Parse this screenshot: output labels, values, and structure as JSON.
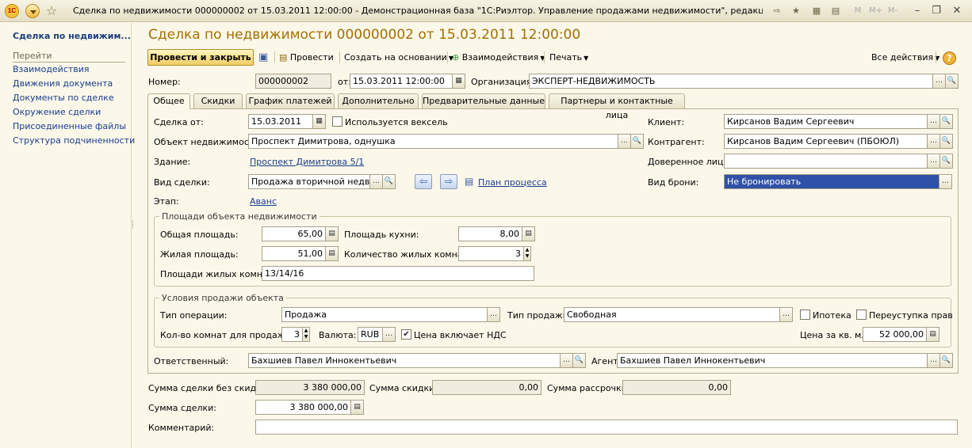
{
  "window": {
    "title": "Сделка по недвижимости 000000002 от 15.03.2011 12:00:00 - Демонстрационная база \"1С:Риэлтор. Управление продажами недвижимости\", редакци... (1С:Предприятие)",
    "logo": "1С",
    "m_labels": [
      "M",
      "M+",
      "M-"
    ]
  },
  "sidebar": {
    "title": "Сделка по недвижим...",
    "group": "Перейти",
    "items": [
      "Взаимодействия",
      "Движения документа",
      "Документы по сделке",
      "Окружение сделки",
      "Присоединенные файлы",
      "Структура подчиненности"
    ]
  },
  "document": {
    "title": "Сделка по недвижимости 000000002 от 15.03.2011 12:00:00"
  },
  "toolbar": {
    "post_close": "Провести и закрыть",
    "post": "Провести",
    "create_based": "Создать на основании",
    "interactions": "Взаимодействия",
    "print": "Печать",
    "all_actions": "Все действия",
    "help": "?"
  },
  "header": {
    "number_label": "Номер:",
    "number_value": "000000002",
    "date_label": "от:",
    "date_value": "15.03.2011 12:00:00",
    "org_label": "Организация:",
    "org_value": "ЭКСПЕРТ-НЕДВИЖИМОСТЬ"
  },
  "tabs": [
    "Общее",
    "Скидки",
    "График платежей",
    "Дополнительно",
    "Предварительные данные",
    "Партнеры и контактные лица"
  ],
  "general": {
    "deal_from_label": "Сделка от:",
    "deal_from_value": "15.03.2011",
    "bill_label": "Используется вексель",
    "object_label": "Объект недвижимости:",
    "object_value": "Проспект Димитрова, однушка",
    "building_label": "Здание:",
    "building_value": "Проспект Димитрова 5/1",
    "deal_type_label": "Вид сделки:",
    "deal_type_value": "Продажа вторичной недвижи",
    "process_plan": "План процесса",
    "stage_label": "Этап:",
    "stage_value": "Аванс",
    "client_label": "Клиент:",
    "client_value": "Кирсанов Вадим Сергеевич",
    "counterparty_label": "Контрагент:",
    "counterparty_value": "Кирсанов Вадим Сергеевич (ПБОЮЛ)",
    "trustee_label": "Доверенное лицо:",
    "trustee_value": "",
    "booking_label": "Вид брони:",
    "booking_value": "Не бронировать"
  },
  "areas": {
    "title": "Площади объекта недвижимости",
    "total_label": "Общая площадь:",
    "total_value": "65,00",
    "kitchen_label": "Площадь кухни:",
    "kitchen_value": "8,00",
    "living_label": "Жилая площадь:",
    "living_value": "51,00",
    "rooms_label": "Количество жилых комнат:",
    "rooms_value": "3",
    "room_areas_label": "Площади жилых комнат:",
    "room_areas_value": "13/14/16"
  },
  "sale": {
    "title": "Условия продажи объекта",
    "operation_label": "Тип операции:",
    "operation_value": "Продажа",
    "sale_type_label": "Тип продажи:",
    "sale_type_value": "Свободная",
    "mortgage_label": "Ипотека",
    "assignment_label": "Переуступка прав",
    "rooms_for_sale_label": "Кол-во комнат для продажи:",
    "rooms_for_sale_value": "3",
    "currency_label": "Валюта:",
    "currency_value": "RUB",
    "vat_label": "Цена включает НДС",
    "price_label": "Цена за кв. м.:",
    "price_value": "52 000,00"
  },
  "people": {
    "responsible_label": "Ответственный:",
    "responsible_value": "Бахшиев Павел Иннокентьевич",
    "agent_label": "Агент:",
    "agent_value": "Бахшиев Павел Иннокентьевич"
  },
  "totals": {
    "no_discount_label": "Сумма сделки без скидок:",
    "no_discount_value": "3 380 000,00",
    "discount_label": "Сумма скидки:",
    "discount_value": "0,00",
    "installment_label": "Сумма рассрочки:",
    "installment_value": "0,00",
    "deal_sum_label": "Сумма сделки:",
    "deal_sum_value": "3 380 000,00",
    "comment_label": "Комментарий:",
    "comment_value": ""
  }
}
